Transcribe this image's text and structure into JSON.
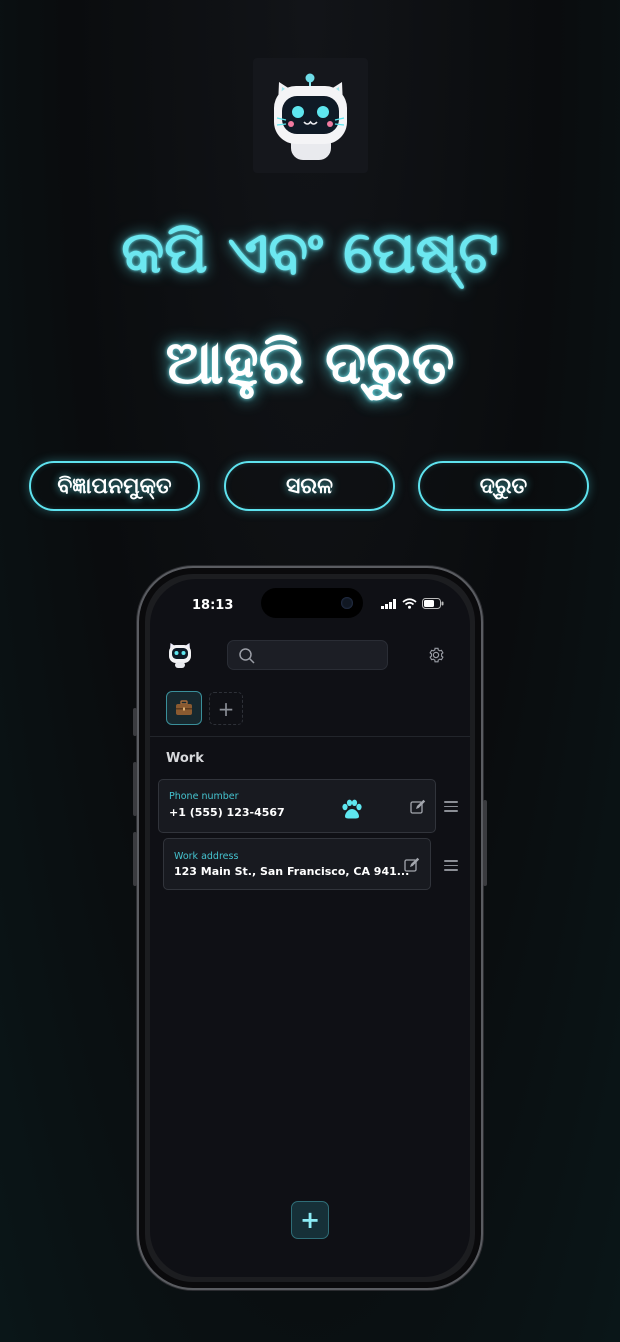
{
  "headline": {
    "line1": "କପି ଏବଂ ପେଷ୍ଟ",
    "line2": "ଆହୁରି ଦ୍ରୁତ"
  },
  "features": [
    "ବିଜ୍ଞାପନମୁକ୍ତ",
    "ସରଳ",
    "ଦ୍ରୁତ"
  ],
  "phone": {
    "status": {
      "time": "18:13"
    },
    "icons": {
      "search": "search-icon",
      "settings": "gear-icon",
      "tab": "briefcase-icon",
      "add_tab": "plus-icon",
      "paw": "paw-icon",
      "edit": "edit-icon",
      "drag": "drag-handle-icon"
    },
    "tabs": {
      "add_label": "+"
    },
    "section": {
      "title": "Work"
    },
    "cards": [
      {
        "label": "Phone number",
        "value": "+1 (555) 123-4567"
      },
      {
        "label": "Work address",
        "value": "123 Main St., San Francisco, CA 941..."
      }
    ],
    "fab_label": "+"
  },
  "colors": {
    "accent": "#5ee2ee",
    "background": "#0a0c0e",
    "screen": "#0f1015",
    "card": "#181a20",
    "label": "#45c3cf"
  }
}
